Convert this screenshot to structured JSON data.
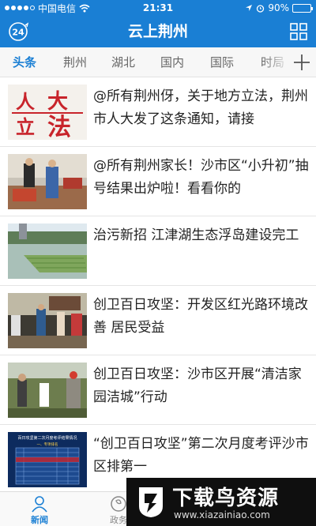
{
  "status_bar": {
    "carrier": "中国电信",
    "time": "21:31",
    "battery_text": "90%",
    "battery_level": 0.9,
    "signal_bars": 4
  },
  "header": {
    "title": "云上荆州",
    "left_icon": "24-hours-icon",
    "left_icon_text": "24",
    "right_icon": "grid-menu-icon"
  },
  "tabs": [
    {
      "label": "头条",
      "active": true
    },
    {
      "label": "荆州",
      "active": false
    },
    {
      "label": "湖北",
      "active": false
    },
    {
      "label": "国内",
      "active": false
    },
    {
      "label": "国际",
      "active": false
    },
    {
      "label": "时局",
      "active": false
    }
  ],
  "news": [
    {
      "title": "@所有荆州伢，关于地方立法，荆州市人大发了这条通知，请接",
      "thumb_text": [
        "人",
        "大",
        "立",
        "法"
      ]
    },
    {
      "title": "@所有荆州家长！沙市区“小升初”抽号结果出炉啦！看看你的"
    },
    {
      "title": "治污新招 江津湖生态浮岛建设完工"
    },
    {
      "title": "创卫百日攻坚：开发区红光路环境改善 居民受益"
    },
    {
      "title": "创卫百日攻坚：沙市区开展“清洁家园洁城”行动"
    },
    {
      "title": "“创卫百日攻坚”第二次月度考评沙市区排第一",
      "thumb_text": [
        "百日攻坚第二次月度考评结果情况",
        "一、专项排名"
      ]
    }
  ],
  "bottom_nav": [
    {
      "label": "新闻",
      "icon": "user-icon",
      "active": true
    },
    {
      "label": "政务",
      "icon": "government-icon",
      "active": false
    }
  ],
  "watermark": {
    "text": "下载鸟资源",
    "url": "www.xiazainiao.com"
  },
  "colors": {
    "brand": "#1a7fd4",
    "red_seal": "#c8242b"
  }
}
